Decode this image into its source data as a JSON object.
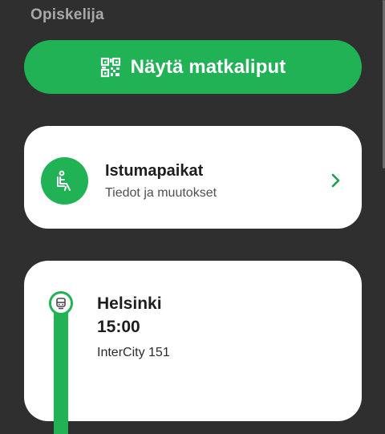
{
  "header": {
    "passenger_type": "Opiskelija"
  },
  "tickets_button": {
    "label": "Näytä matkaliput",
    "icon": "qr-code-icon",
    "color": "#20b254"
  },
  "seats_card": {
    "title": "Istumapaikat",
    "subtitle": "Tiedot ja muutokset",
    "icon": "seat-icon",
    "chevron_icon": "chevron-right-icon"
  },
  "journey": {
    "departure_station": "Helsinki",
    "departure_time": "15:00",
    "train": "InterCity 151",
    "icon": "train-icon"
  },
  "colors": {
    "accent": "#20b254",
    "background": "#2f2f2f",
    "card": "#ffffff"
  }
}
